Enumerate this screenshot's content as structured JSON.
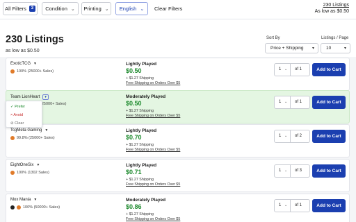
{
  "filters": {
    "all_filters": {
      "label": "All Filters",
      "count": "3"
    },
    "condition": "Condition",
    "printing": "Printing",
    "language": "English",
    "clear": "Clear Filters"
  },
  "summary": {
    "count": "230 Listings",
    "low": "As low as $0.50"
  },
  "header": {
    "title": "230 Listings",
    "subtitle": "as low as $0.50",
    "sort_label": "Sort By",
    "sort_value": "Price + Shipping",
    "perpage_label": "Listings / Page",
    "perpage_value": "10"
  },
  "listings": [
    {
      "seller": "ExoticTCG",
      "rating": "100% (25000+ Sales)",
      "condition": "Lightly Played",
      "price": "$0.50",
      "shipping": "+ $1.27 Shipping",
      "free_shipping": "Free Shipping on Orders Over $5",
      "qty": "1",
      "of": "of 1",
      "highlighted": false
    },
    {
      "seller": "Team LionHeart",
      "rating": "(25000+ Sales)",
      "condition": "Moderately Played",
      "price": "$0.50",
      "shipping": "+ $1.27 Shipping",
      "free_shipping": "Free Shipping on Orders Over $5",
      "qty": "1",
      "of": "of 1",
      "highlighted": true
    },
    {
      "seller": "TcgMeta Gaming",
      "rating": "99.8% (25000+ Sales)",
      "condition": "Lightly Played",
      "price": "$0.70",
      "shipping": "+ $1.27 Shipping",
      "free_shipping": "Free Shipping on Orders Over $5",
      "qty": "1",
      "of": "of 2",
      "highlighted": false
    },
    {
      "seller": "EightOneSix",
      "rating": "100% (1302 Sales)",
      "condition": "Lightly Played",
      "price": "$0.71",
      "shipping": "+ $1.27 Shipping",
      "free_shipping": "Free Shipping on Orders Over $5",
      "qty": "1",
      "of": "of 3",
      "highlighted": false
    },
    {
      "seller": "Mox Mania",
      "rating": "100% (50000+ Sales)",
      "condition": "Moderately Played",
      "price": "$0.86",
      "shipping": "+ $1.27 Shipping",
      "free_shipping": "Free Shipping on Orders Over $5",
      "qty": "1",
      "of": "of 1",
      "highlighted": false
    }
  ],
  "add_to_cart": "Add to Cart",
  "seller_menu": {
    "prefer": "✓ Prefer",
    "avoid": "× Avoid",
    "clear": "⊘ Clear"
  },
  "colors": {
    "accent": "#1b3fb0",
    "price": "#1e8a2e",
    "highlight": "#e4f6e2",
    "avoid": "#c62828"
  }
}
